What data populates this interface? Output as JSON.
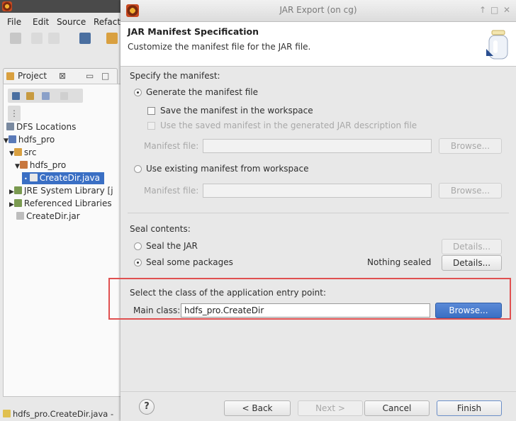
{
  "eclipse": {
    "menu": [
      "File",
      "Edit",
      "Source",
      "Refactor"
    ],
    "project_tab": "Project",
    "tree": [
      {
        "label": "DFS Locations",
        "icon": "dfs-icon"
      },
      {
        "label": "hdfs_pro",
        "icon": "project-icon"
      },
      {
        "label": "src",
        "icon": "folder-icon"
      },
      {
        "label": "hdfs_pro",
        "icon": "package-icon"
      },
      {
        "label": "CreateDir.java",
        "icon": "java-file-icon",
        "selected": true
      },
      {
        "label": "JRE System Library [j",
        "icon": "library-icon"
      },
      {
        "label": "Referenced Libraries",
        "icon": "library-icon"
      },
      {
        "label": "CreateDir.jar",
        "icon": "jar-file-icon"
      }
    ],
    "status": "hdfs_pro.CreateDir.java -"
  },
  "dialog": {
    "title": "JAR Export  (on cg)",
    "header_title": "JAR Manifest Specification",
    "header_desc": "Customize the manifest file for the JAR file.",
    "specify_label": "Specify the manifest:",
    "generate_label": "Generate the manifest file",
    "save_manifest_label": "Save the manifest in the workspace",
    "use_saved_label": "Use the saved manifest in the generated JAR description file",
    "manifest_file_label": "Manifest file:",
    "browse_label": "Browse...",
    "use_existing_label": "Use existing manifest from workspace",
    "seal_contents_label": "Seal contents:",
    "seal_jar_label": "Seal the JAR",
    "seal_packages_label": "Seal some packages",
    "nothing_sealed": "Nothing sealed",
    "details_label": "Details...",
    "entry_point_label": "Select the class of the application entry point:",
    "main_class_label": "Main class:",
    "main_class_value": "hdfs_pro.CreateDir",
    "buttons": {
      "help": "?",
      "back": "< Back",
      "next": "Next >",
      "cancel": "Cancel",
      "finish": "Finish"
    }
  },
  "colors": {
    "highlight": "#e05050",
    "selection": "#3a6fc4"
  }
}
